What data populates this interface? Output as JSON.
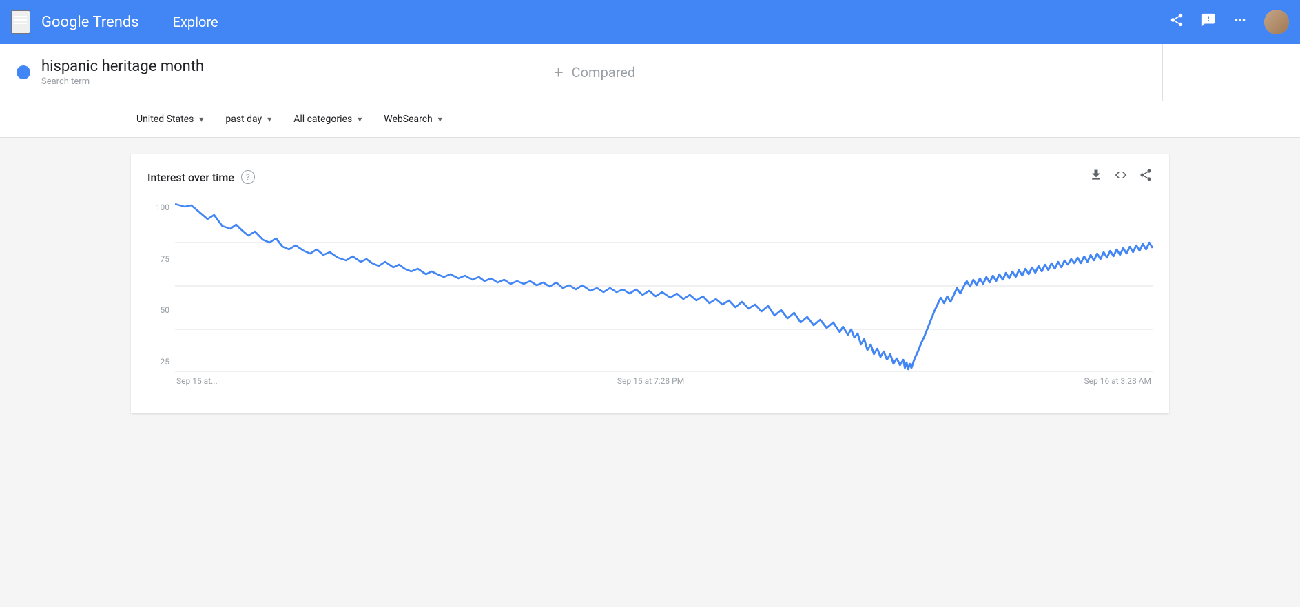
{
  "header": {
    "logo_text": "Google Trends",
    "explore_label": "Explore",
    "menu_icon": "☰",
    "share_icon": "⎗",
    "feedback_icon": "⚑",
    "apps_icon": "⋮⋮⋮"
  },
  "search": {
    "term_text": "hispanic heritage month",
    "term_label": "Search term",
    "compare_text": "Compared",
    "compare_plus": "+"
  },
  "filters": {
    "region": "United States",
    "time_range": "past day",
    "category": "All categories",
    "search_type": "WebSearch"
  },
  "chart": {
    "title": "Interest over time",
    "help_label": "?",
    "download_label": "⬇",
    "embed_label": "<>",
    "share_label": "⎗",
    "y_labels": [
      "100",
      "75",
      "50",
      "25"
    ],
    "x_labels": [
      "Sep 15 at...",
      "Sep 15 at 7:28 PM",
      "Sep 16 at 3:28 AM"
    ],
    "line_color": "#4285f4"
  }
}
